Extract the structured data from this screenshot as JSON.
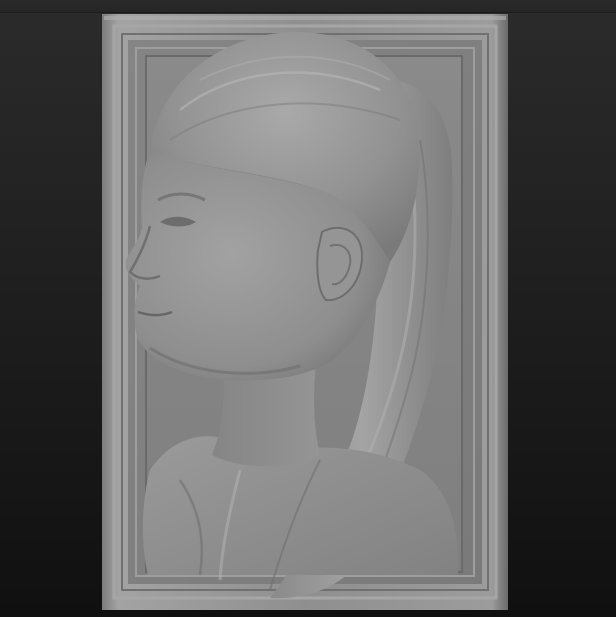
{
  "viewport": {
    "background_top": "#2b2b2b",
    "background_bottom": "#101010"
  },
  "model": {
    "subject": "relief-portrait",
    "material_base": "#8a8a8a",
    "material_highlight": "#bdbdbd",
    "material_shadow": "#4a4a4a"
  }
}
